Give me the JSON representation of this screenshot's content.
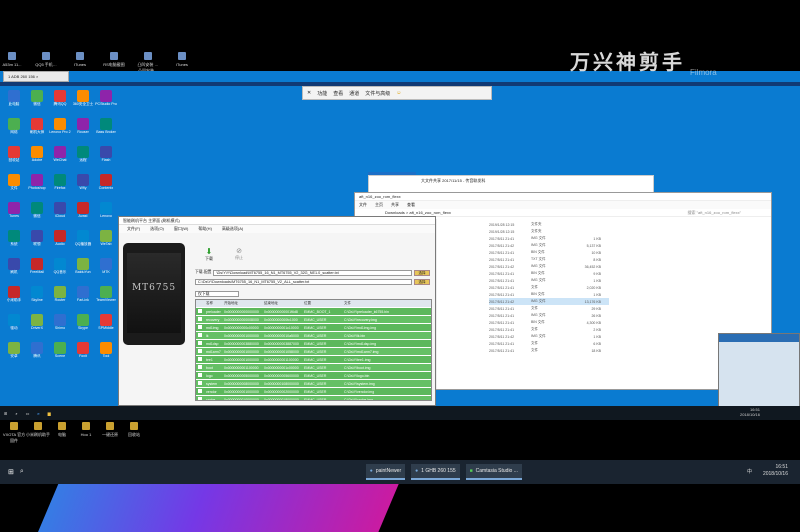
{
  "host_top_icons": [
    "A53m 11...",
    "QQ5 手机…",
    "ITunes",
    "RS电脑截图",
    "凸凹安装 … 凸凹安装…",
    "iTunes"
  ],
  "remote_tab": "1 ADB 260 156",
  "remote_toolbar": [
    "功能",
    "查看",
    "通道",
    "文件与高级"
  ],
  "remote_icons": [
    [
      "此电脑",
      "微信",
      "腾讯QQ",
      "360安全卫士",
      "PCStudio Pro"
    ],
    [
      "网络",
      "刷机大师",
      "Lenovo Pro 2",
      "Rouser",
      "Bass Broker"
    ],
    [
      "回收站",
      "Adobe",
      "WeChat",
      "远程",
      "Flash"
    ],
    [
      "文件",
      "Photoshop",
      "Firefox",
      "Wfly",
      "Contentx"
    ],
    [
      "Tunes",
      "微信",
      "iCloud",
      "Avast",
      "Lenovo"
    ],
    [
      "系统",
      "联想",
      "Audio",
      "QQ播放器",
      "WeTab"
    ],
    [
      "刷机",
      "FreeMail",
      "QQ音乐",
      "BaiduYun",
      "MTK"
    ],
    [
      "小米助手",
      "Skyline",
      "Router",
      "FarLink",
      "TeamViewer"
    ],
    [
      "驱动",
      "DriverX",
      "Shimo",
      "Skype",
      "SPMiddle"
    ],
    [
      "安卓",
      "腾讯",
      "Scene",
      "Foxit",
      "Tool"
    ]
  ],
  "flash_tool": {
    "title": "智能刷机平台 主界面 (刷机模式)",
    "menu": [
      "文件(F)",
      "选项(O)",
      "窗口(W)",
      "帮助(H)",
      "高级选项(A)"
    ],
    "phone_label": "MT6755",
    "download_button": "下载",
    "stop_button": "停止",
    "path_label": "下载-配置",
    "path1": "\\Ds\\Y\\Y\\Download\\MT6755_16_N1_MT6755_V2_32G_NE1.0_scatter.txt",
    "path2": "C:\\Ds\\Y\\Downloads\\MT6755_16_N1_MT6755_V2_ALL_scatter.txt",
    "file_button": "选择",
    "mode": "仅下载",
    "columns": [
      "",
      "名称",
      "开始地址",
      "结束地址",
      "位置",
      "文件"
    ],
    "rows": [
      [
        "preloader",
        "0x0000000000000000",
        "0x000000000001f6d8",
        "EMMC_BOOT_1",
        "C:\\Ds\\Y\\preloader_k6755.bin"
      ],
      [
        "recovery",
        "0x0000000000008000",
        "0x0000000000fc1000",
        "EMMC_USER",
        "C:\\Ds\\Y\\recovery.img"
      ],
      [
        "md1img",
        "0x0000000000c00000",
        "0x0000000001c10000",
        "EMMC_USER",
        "C:\\Ds\\Y\\md1img.img"
      ],
      [
        "lk",
        "0x0000000001000000",
        "0x00000000010a5000",
        "EMMC_USER",
        "C:\\Ds\\Y\\lk.bin"
      ],
      [
        "md1dsp",
        "0x0000000003880000",
        "0x0000000003887000",
        "EMMC_USER",
        "C:\\Ds\\Y\\md1dsp.img"
      ],
      [
        "md1arm7",
        "0x0000000001000000",
        "0x0000000001058000",
        "EMMC_USER",
        "C:\\Ds\\Y\\md1arm7.img"
      ],
      [
        "tee1",
        "0x0000000001000000",
        "0x0000000001100000",
        "EMMC_USER",
        "C:\\Ds\\Y\\tee1.img"
      ],
      [
        "boot",
        "0x0000000001100000",
        "0x0000000001c00000",
        "EMMC_USER",
        "C:\\Ds\\Y\\boot.img"
      ],
      [
        "logo",
        "0x0000000005000000",
        "0x0000000005600000",
        "EMMC_USER",
        "C:\\Ds\\Y\\logo.bin"
      ],
      [
        "system",
        "0x0000000008000000",
        "0x0000000108000000",
        "EMMC_USER",
        "C:\\Ds\\Y\\system.img"
      ],
      [
        "vendor",
        "0x0000000001000000",
        "0x0000000002000000",
        "EMMC_USER",
        "C:\\Ds\\Y\\vendor.img"
      ],
      [
        "cache",
        "0x0000000010000000",
        "0x0000000018000000",
        "EMMC_USER",
        "C:\\Ds\\Y\\cache.img"
      ]
    ]
  },
  "explorer": {
    "back_title": "大文件共享 2017/11/15 - 传音联发科",
    "title": "aft_n16_zoo_rom_flexx",
    "ribbon": [
      "文件",
      "主页",
      "共享",
      "查看"
    ],
    "address": "Downloads > aft_n16_zoo_rom_flexx",
    "search": "搜索 \"aft_n16_zoo_rom_flexx\"",
    "nav": [
      "快速访问",
      "桌面",
      "下载",
      "文档",
      "图片",
      "此电脑",
      "网络"
    ],
    "rows": [
      [
        "2019/1/28 12:15",
        "文件夹",
        ""
      ],
      [
        "2019/1/28 12:15",
        "文件夹",
        ""
      ],
      [
        "2017/5/11 21:41",
        "IMG 文件",
        "1 KB"
      ],
      [
        "2017/5/11 21:42",
        "IMG 文件",
        "5,137 KB"
      ],
      [
        "2017/5/11 21:41",
        "BIN 文件",
        "10 KB"
      ],
      [
        "2017/5/11 21:41",
        "TXT 文件",
        "8 KB"
      ],
      [
        "2017/5/11 21:42",
        "IMG 文件",
        "36,452 KB"
      ],
      [
        "2017/5/11 21:41",
        "BIN 文件",
        "9 KB"
      ],
      [
        "2017/5/11 21:41",
        "IMG 文件",
        "1 KB"
      ],
      [
        "2017/5/11 21:41",
        "文件",
        "2,020 KB"
      ],
      [
        "2017/5/11 21:41",
        "BIN 文件",
        "1 KB"
      ],
      [
        "2017/5/11 21:42",
        "IMG 文件",
        "13,176 KB"
      ],
      [
        "2017/5/11 21:41",
        "文件",
        "29 KB"
      ],
      [
        "2017/5/11 21:41",
        "IMG 文件",
        "26 KB"
      ],
      [
        "2017/5/11 21:41",
        "BIN 文件",
        "4,300 KB"
      ],
      [
        "2017/5/11 21:41",
        "文件",
        "2 KB"
      ],
      [
        "2017/5/11 21:42",
        "IMG 文件",
        "1 KB"
      ],
      [
        "2017/5/11 21:41",
        "文件",
        "6 KB"
      ],
      [
        "2017/5/11 21:41",
        "文件",
        "18 KB"
      ]
    ],
    "status": "23 个项目   选中 1 个项目"
  },
  "remote_taskbar": {
    "clock_time": "16:51",
    "clock_date": "2018/10/16"
  },
  "host_taskbar": {
    "apps": [
      "paintNewer",
      "1 GHB 260 155",
      "Camtasia Studio ..."
    ],
    "clock_time": "16:51",
    "clock_date": "2018/10/16",
    "lang": "中"
  },
  "host_desktop_bottom": [
    "VXOTA  官方固件",
    "小米刷机助手",
    "电脑",
    "Hoo 1",
    "一键还原",
    "回收站"
  ],
  "watermark": "万兴神剪手",
  "watermark_sub": "Filmora"
}
